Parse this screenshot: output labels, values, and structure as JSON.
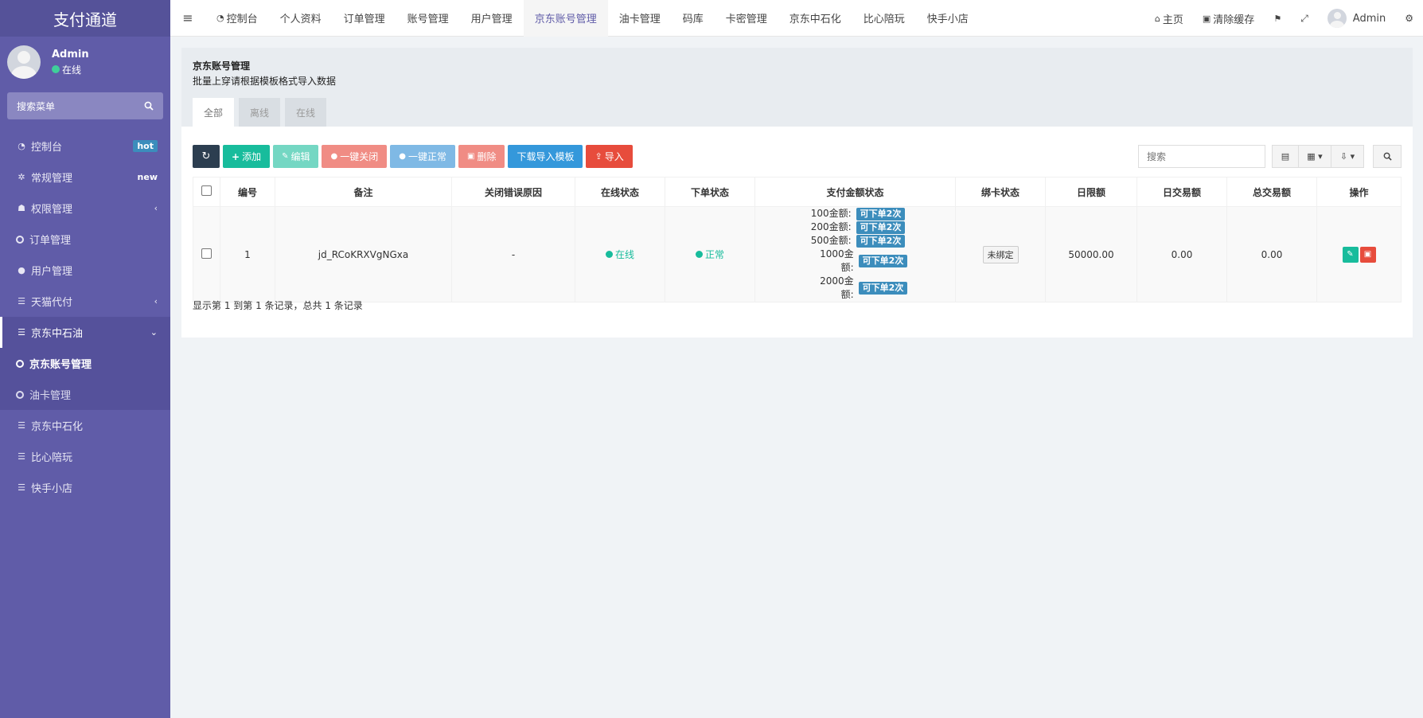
{
  "sidebar": {
    "brand": "支付通道",
    "user": {
      "name": "Admin",
      "status": "在线"
    },
    "search_placeholder": "搜索菜单",
    "items": [
      {
        "label": "控制台",
        "badge": "hot"
      },
      {
        "label": "常规管理",
        "badge": "new"
      },
      {
        "label": "权限管理"
      },
      {
        "label": "订单管理"
      },
      {
        "label": "用户管理"
      },
      {
        "label": "天猫代付"
      },
      {
        "label": "京东中石油"
      }
    ],
    "subitems": [
      {
        "label": "京东账号管理"
      },
      {
        "label": "油卡管理"
      }
    ],
    "items_after": [
      {
        "label": "京东中石化"
      },
      {
        "label": "比心陪玩"
      },
      {
        "label": "快手小店"
      }
    ]
  },
  "topnav": {
    "tabs": [
      "控制台",
      "个人资料",
      "订单管理",
      "账号管理",
      "用户管理",
      "京东账号管理",
      "油卡管理",
      "码库",
      "卡密管理",
      "京东中石化",
      "比心陪玩",
      "快手小店"
    ],
    "active_tab": "京东账号管理",
    "home": "主页",
    "clear_cache": "清除缓存",
    "user": "Admin"
  },
  "panel": {
    "title": "京东账号管理",
    "description": "批量上穿请根据模板格式导入数据",
    "tabs": [
      "全部",
      "离线",
      "在线"
    ],
    "active_tab": "全部"
  },
  "toolbar": {
    "add": "添加",
    "edit": "编辑",
    "close_all": "一键关闭",
    "normal_all": "一键正常",
    "delete": "删除",
    "download_template": "下载导入模板",
    "import": "导入",
    "search_placeholder": "搜索"
  },
  "table": {
    "headers": [
      "编号",
      "备注",
      "关闭错误原因",
      "在线状态",
      "下单状态",
      "支付金额状态",
      "绑卡状态",
      "日限额",
      "日交易额",
      "总交易额",
      "操作"
    ],
    "rows": [
      {
        "id": "1",
        "remark": "jd_RCoKRXVgNGxa",
        "close_reason": "-",
        "online_status": "在线",
        "order_status": "正常",
        "amounts": [
          {
            "label": "100金额:",
            "status": "可下单2次"
          },
          {
            "label": "200金额:",
            "status": "可下单2次"
          },
          {
            "label": "500金额:",
            "status": "可下单2次"
          },
          {
            "label": "1000金额:",
            "status": "可下单2次"
          },
          {
            "label": "2000金额:",
            "status": "可下单2次"
          }
        ],
        "bind_status": "未绑定",
        "daily_limit": "50000.00",
        "daily_volume": "0.00",
        "total_volume": "0.00"
      }
    ]
  },
  "footer": {
    "records": "显示第 1 到第 1 条记录，总共 1 条记录"
  },
  "colors": {
    "sidebar": "#605ca8",
    "accent": "#605ca8",
    "success": "#18bc9c",
    "danger": "#e74c3c",
    "primary": "#3498db"
  }
}
